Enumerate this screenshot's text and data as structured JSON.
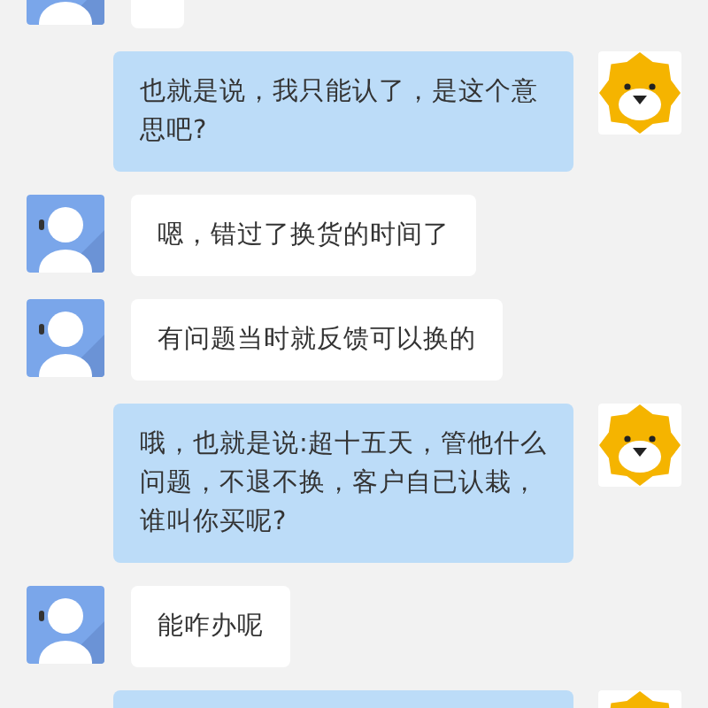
{
  "messages": [
    {
      "kind": "agent"
    },
    {
      "kind": "user",
      "text": "也就是说，我只能认了，是这个意思吧?"
    },
    {
      "kind": "agent",
      "text": "嗯，错过了换货的时间了"
    },
    {
      "kind": "agent",
      "text": "有问题当时就反馈可以换的"
    },
    {
      "kind": "user",
      "text": "哦，也就是说:超十五天，管他什么问题，不退不换，客户自已认栽，谁叫你买呢?"
    },
    {
      "kind": "agent",
      "text": "能咋办呢"
    },
    {
      "kind": "user"
    }
  ]
}
